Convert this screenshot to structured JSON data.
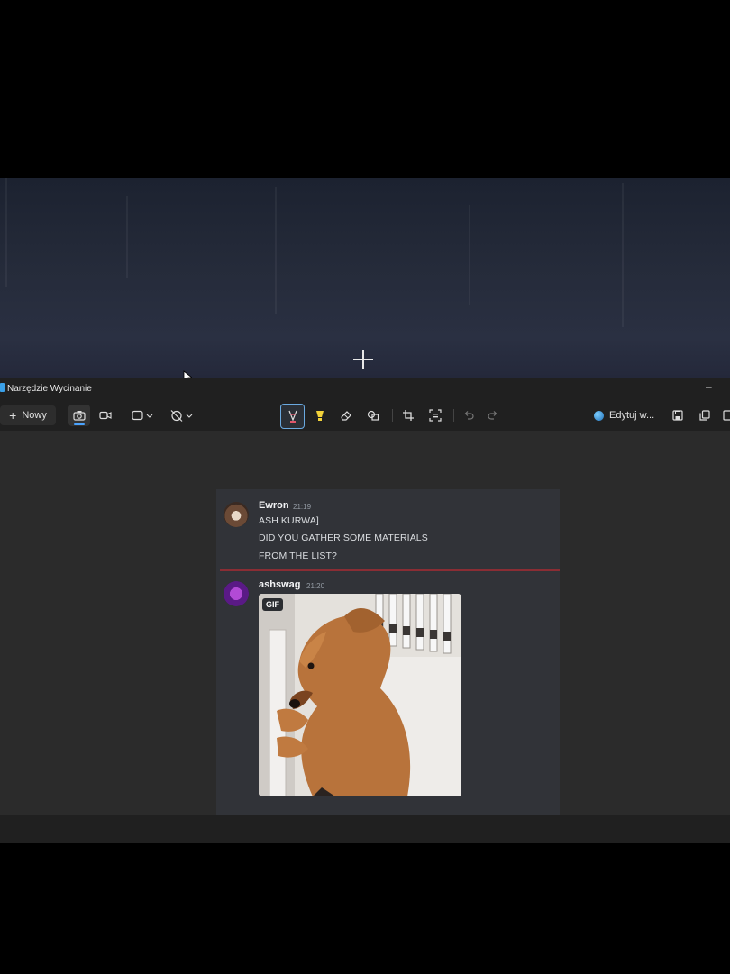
{
  "window": {
    "title": "Narzędzie Wycinanie",
    "minimize_glyph": "–"
  },
  "toolbar": {
    "new_label": "Nowy",
    "new_glyph": "+",
    "edit_label": "Edytuj w...",
    "icons": [
      "camera-icon",
      "video-icon",
      "rectangle-mode-icon",
      "timer-off-icon",
      "ballpoint-pen-icon",
      "highlighter-icon",
      "eraser-icon",
      "shapes-icon",
      "crop-icon",
      "text-actions-icon",
      "undo-icon",
      "redo-icon",
      "paint-globe-icon",
      "save-icon",
      "copy-icon"
    ]
  },
  "chat": {
    "messages": [
      {
        "author": "Ewron",
        "time": "21:19",
        "lines": [
          "ASH KURWA]",
          "DID YOU GATHER SOME MATERIALS",
          "FROM THE LIST?"
        ]
      },
      {
        "author": "ashswag",
        "time": "21:20",
        "attachment_badge": "GIF"
      }
    ]
  },
  "colors": {
    "accent_blue": "#4aa3ff",
    "divider_red": "#8a2d34",
    "chat_bg": "#313338",
    "toolbar_bg": "#202020"
  }
}
